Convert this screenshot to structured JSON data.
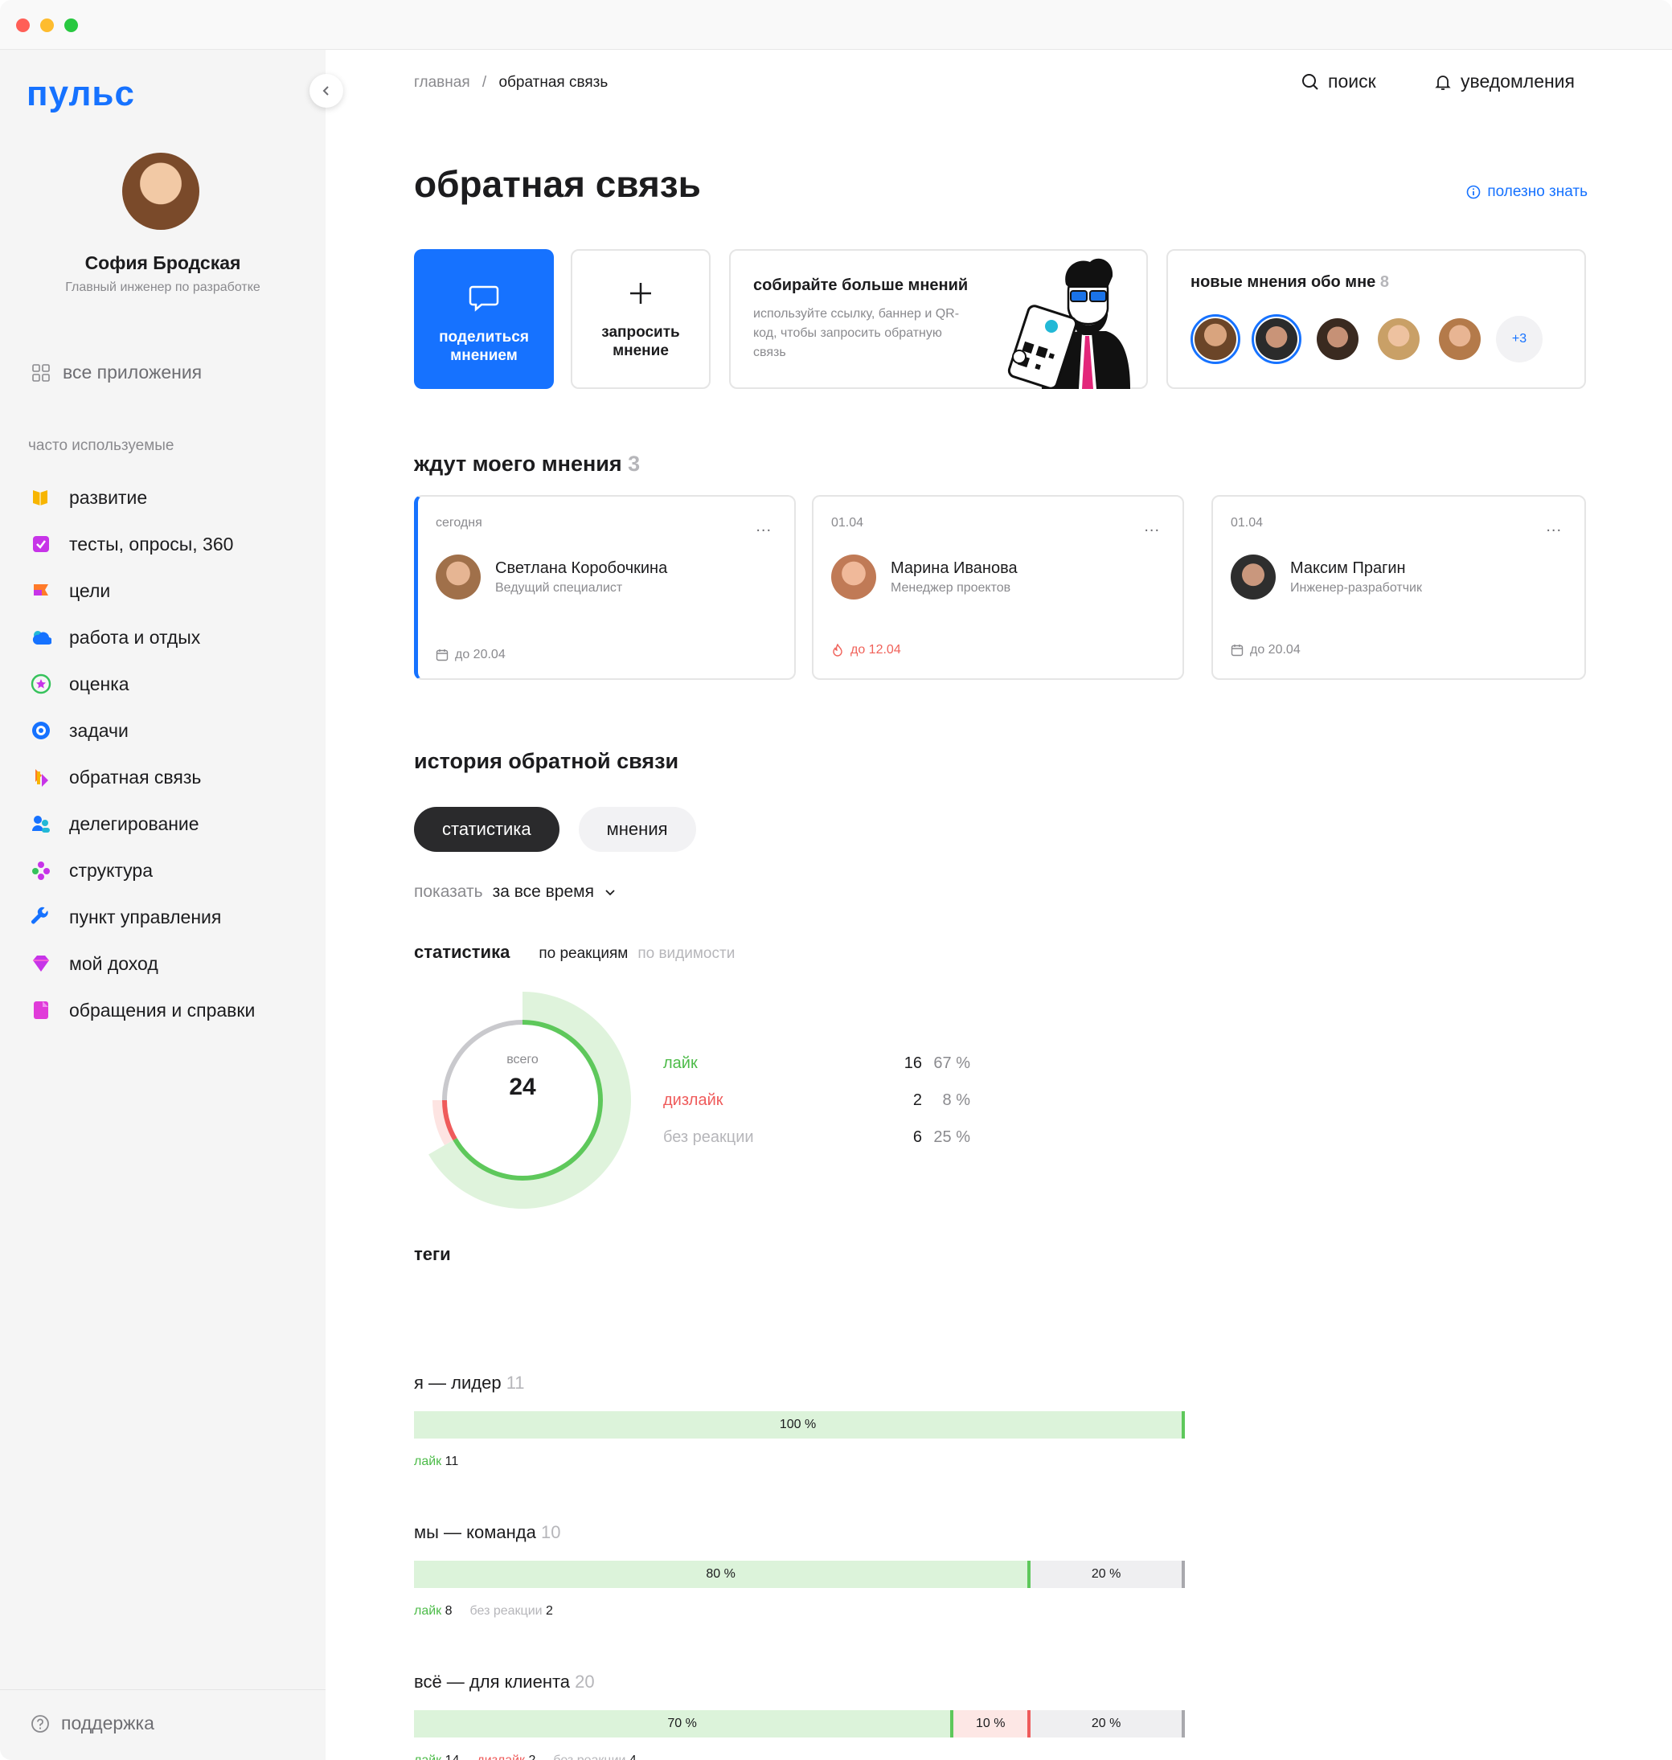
{
  "app": {
    "logo": "пульс"
  },
  "user": {
    "name": "София Бродская",
    "role": "Главный инженер по разработке"
  },
  "sidebar": {
    "all_apps": "все приложения",
    "frequent_label": "часто используемые",
    "items": [
      {
        "label": "развитие",
        "icon": "book-icon",
        "color": "#f7b500"
      },
      {
        "label": "тесты, опросы, 360",
        "icon": "checkbox-icon",
        "color": "#c734e8"
      },
      {
        "label": "цели",
        "icon": "flag-icon",
        "color": "#ff7a29"
      },
      {
        "label": "работа и отдых",
        "icon": "weather-icon",
        "color": "#1672ff"
      },
      {
        "label": "оценка",
        "icon": "star-icon",
        "color": "#36c25b"
      },
      {
        "label": "задачи",
        "icon": "target-icon",
        "color": "#1672ff"
      },
      {
        "label": "обратная связь",
        "icon": "feedback-icon",
        "color": "#ff7a29"
      },
      {
        "label": "делегирование",
        "icon": "people-icon",
        "color": "#1672ff"
      },
      {
        "label": "структура",
        "icon": "structure-icon",
        "color": "#c734e8"
      },
      {
        "label": "пункт управления",
        "icon": "wrench-icon",
        "color": "#1672ff"
      },
      {
        "label": "мой доход",
        "icon": "diamond-icon",
        "color": "#c734e8"
      },
      {
        "label": "обращения и справки",
        "icon": "document-icon",
        "color": "#e03bd9"
      }
    ],
    "support": "поддержка"
  },
  "header": {
    "crumb_home": "главная",
    "crumb_sep": "/",
    "crumb_current": "обратная связь",
    "search": "поиск",
    "notifications": "уведомления"
  },
  "page": {
    "title": "обратная связь",
    "useful": "полезно знать"
  },
  "actions": {
    "share": "поделиться мнением",
    "request": "запросить мнение"
  },
  "promo": {
    "title": "собирайте больше мнений",
    "text": "используйте ссылку, баннер и QR-код, чтобы запросить обратную связь"
  },
  "new_opinions": {
    "title": "новые мнения обо мне",
    "count": "8",
    "more": "+3"
  },
  "waiting": {
    "title": "ждут моего мнения",
    "count": "3",
    "menu": "...",
    "cards": [
      {
        "date": "сегодня",
        "name": "Светлана Коробочкина",
        "role": "Ведущий специалист",
        "due": "до 20.04",
        "overdue": false
      },
      {
        "date": "01.04",
        "name": "Марина Иванова",
        "role": "Менеджер проектов",
        "due": "до 12.04",
        "overdue": true
      },
      {
        "date": "01.04",
        "name": "Максим Прагин",
        "role": "Инженер-разработчик",
        "due": "до 20.04",
        "overdue": false
      }
    ]
  },
  "history": {
    "title": "история обратной связи",
    "tab_stats": "статистика",
    "tab_opinions": "мнения",
    "show_label": "показать",
    "show_value": "за все время",
    "stats_title": "статистика",
    "by_reactions": "по реакциям",
    "by_visibility": "по видимости",
    "total_label": "всего",
    "total": "24",
    "reactions": [
      {
        "label": "лайк",
        "count": "16",
        "percent": "67 %",
        "color": "#4cbb48"
      },
      {
        "label": "дизлайк",
        "count": "2",
        "percent": "8 %",
        "color": "#ef5b5b"
      },
      {
        "label": "без реакции",
        "count": "6",
        "percent": "25 %",
        "color": "#b6b6ba"
      }
    ]
  },
  "chart_data": {
    "type": "pie",
    "categories": [
      "лайк",
      "дизлайк",
      "без реакции"
    ],
    "values": [
      16,
      2,
      6
    ],
    "percents": [
      67,
      8,
      25
    ]
  },
  "tags": {
    "title": "теги",
    "items": [
      {
        "name": "я — лидер",
        "count": "11",
        "like": "11",
        "dislike": "",
        "none": "",
        "like_pct": "100 %",
        "dislike_pct": "",
        "none_pct": "",
        "like_val": 100,
        "dislike_val": 0,
        "none_val": 0
      },
      {
        "name": "мы — команда",
        "count": "10",
        "like": "8",
        "dislike": "",
        "none": "2",
        "like_pct": "80 %",
        "dislike_pct": "",
        "none_pct": "20 %",
        "like_val": 80,
        "dislike_val": 0,
        "none_val": 20
      },
      {
        "name": "всё — для клиента",
        "count": "20",
        "like": "14",
        "dislike": "2",
        "none": "4",
        "like_pct": "70 %",
        "dislike_pct": "10 %",
        "none_pct": "20 %",
        "like_val": 70,
        "dislike_val": 10,
        "none_val": 20
      }
    ],
    "like_label": "лайк",
    "dislike_label": "дизлайк",
    "none_label": "без реакции"
  }
}
